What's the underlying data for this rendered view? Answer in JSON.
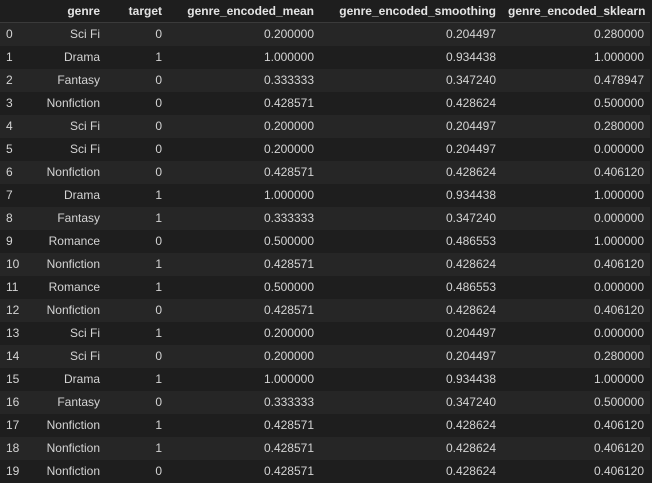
{
  "columns": {
    "index": "",
    "genre": "genre",
    "target": "target",
    "mean": "genre_encoded_mean",
    "smoothing": "genre_encoded_smoothing",
    "sklearn": "genre_encoded_sklearn"
  },
  "rows": [
    {
      "idx": "0",
      "genre": "Sci Fi",
      "target": "0",
      "mean": "0.200000",
      "smoothing": "0.204497",
      "sklearn": "0.280000"
    },
    {
      "idx": "1",
      "genre": "Drama",
      "target": "1",
      "mean": "1.000000",
      "smoothing": "0.934438",
      "sklearn": "1.000000"
    },
    {
      "idx": "2",
      "genre": "Fantasy",
      "target": "0",
      "mean": "0.333333",
      "smoothing": "0.347240",
      "sklearn": "0.478947"
    },
    {
      "idx": "3",
      "genre": "Nonfiction",
      "target": "0",
      "mean": "0.428571",
      "smoothing": "0.428624",
      "sklearn": "0.500000"
    },
    {
      "idx": "4",
      "genre": "Sci Fi",
      "target": "0",
      "mean": "0.200000",
      "smoothing": "0.204497",
      "sklearn": "0.280000"
    },
    {
      "idx": "5",
      "genre": "Sci Fi",
      "target": "0",
      "mean": "0.200000",
      "smoothing": "0.204497",
      "sklearn": "0.000000"
    },
    {
      "idx": "6",
      "genre": "Nonfiction",
      "target": "0",
      "mean": "0.428571",
      "smoothing": "0.428624",
      "sklearn": "0.406120"
    },
    {
      "idx": "7",
      "genre": "Drama",
      "target": "1",
      "mean": "1.000000",
      "smoothing": "0.934438",
      "sklearn": "1.000000"
    },
    {
      "idx": "8",
      "genre": "Fantasy",
      "target": "1",
      "mean": "0.333333",
      "smoothing": "0.347240",
      "sklearn": "0.000000"
    },
    {
      "idx": "9",
      "genre": "Romance",
      "target": "0",
      "mean": "0.500000",
      "smoothing": "0.486553",
      "sklearn": "1.000000"
    },
    {
      "idx": "10",
      "genre": "Nonfiction",
      "target": "1",
      "mean": "0.428571",
      "smoothing": "0.428624",
      "sklearn": "0.406120"
    },
    {
      "idx": "11",
      "genre": "Romance",
      "target": "1",
      "mean": "0.500000",
      "smoothing": "0.486553",
      "sklearn": "0.000000"
    },
    {
      "idx": "12",
      "genre": "Nonfiction",
      "target": "0",
      "mean": "0.428571",
      "smoothing": "0.428624",
      "sklearn": "0.406120"
    },
    {
      "idx": "13",
      "genre": "Sci Fi",
      "target": "1",
      "mean": "0.200000",
      "smoothing": "0.204497",
      "sklearn": "0.000000"
    },
    {
      "idx": "14",
      "genre": "Sci Fi",
      "target": "0",
      "mean": "0.200000",
      "smoothing": "0.204497",
      "sklearn": "0.280000"
    },
    {
      "idx": "15",
      "genre": "Drama",
      "target": "1",
      "mean": "1.000000",
      "smoothing": "0.934438",
      "sklearn": "1.000000"
    },
    {
      "idx": "16",
      "genre": "Fantasy",
      "target": "0",
      "mean": "0.333333",
      "smoothing": "0.347240",
      "sklearn": "0.500000"
    },
    {
      "idx": "17",
      "genre": "Nonfiction",
      "target": "1",
      "mean": "0.428571",
      "smoothing": "0.428624",
      "sklearn": "0.406120"
    },
    {
      "idx": "18",
      "genre": "Nonfiction",
      "target": "1",
      "mean": "0.428571",
      "smoothing": "0.428624",
      "sklearn": "0.406120"
    },
    {
      "idx": "19",
      "genre": "Nonfiction",
      "target": "0",
      "mean": "0.428571",
      "smoothing": "0.428624",
      "sklearn": "0.406120"
    }
  ]
}
